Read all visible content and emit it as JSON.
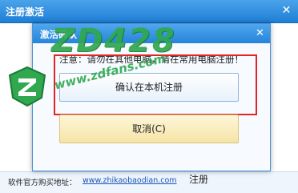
{
  "window": {
    "title": "注册激活",
    "close_glyph": "✕"
  },
  "dialog": {
    "title": "激活确认",
    "close_glyph": "✕",
    "warning": "注意：请勿在其他电脑，请在常用电脑注册！",
    "confirm_label": "确认在本机注册",
    "cancel_label": "取消(C)"
  },
  "footer": {
    "label": "软件官方购买地址：",
    "link": "www.zhikaobaodian.com",
    "register_fragment": "注册"
  },
  "watermark": {
    "brand": "ZD428",
    "url": "www.zdfans.com",
    "logo_icon": "zd-shield-logo"
  },
  "colors": {
    "titlebar": "#2684da",
    "highlight": "#e02525",
    "watermark": "#2fa84f",
    "link": "#1a55b8"
  }
}
